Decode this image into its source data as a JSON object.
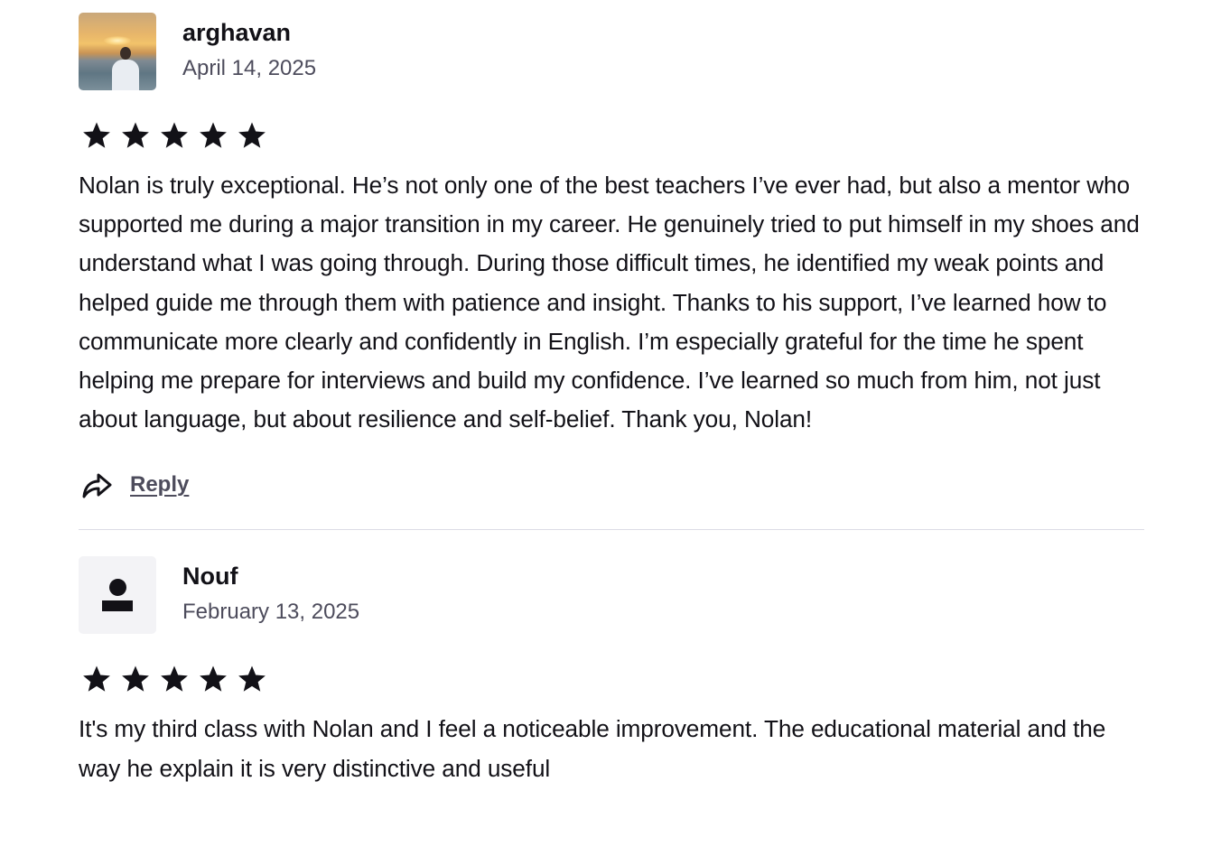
{
  "reviews": [
    {
      "author": "arghavan",
      "date": "April 14, 2025",
      "rating": 5,
      "avatar": "photo",
      "text": "Nolan is truly exceptional. He’s not only one of the best teachers I’ve ever had, but also a mentor who supported me during a major transition in my career. He genuinely tried to put himself in my shoes and understand what I was going through. During those difficult times, he identified my weak points and helped guide me through them with patience and insight. Thanks to his support, I’ve learned how to communicate more clearly and confidently in English. I’m especially grateful for the time he spent helping me prepare for interviews and build my confidence. I’ve learned so much from him, not just about language, but about resilience and self-belief. Thank you, Nolan!",
      "reply_label": "Reply",
      "reply_icon": "share-arrow-icon"
    },
    {
      "author": "Nouf",
      "date": "February 13, 2025",
      "rating": 5,
      "avatar": "default-user-icon",
      "text": "It's my third class with Nolan and I feel a noticeable improvement. The educational material and the way he explain it is very distinctive and useful"
    }
  ],
  "colors": {
    "text": "#121117",
    "muted": "#4d4c5c",
    "divider": "#dcdce5",
    "avatar_bg": "#f3f3f6"
  }
}
